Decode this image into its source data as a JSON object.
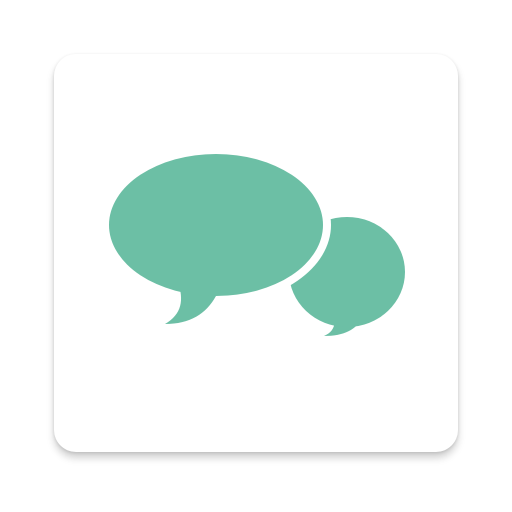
{
  "app_icon": {
    "icon_name": "chat-bubbles-icon",
    "colors": {
      "tile_background": "#ffffff",
      "bubble_fill": "#6cbfa5",
      "bubble_outline": "#ffffff"
    }
  }
}
